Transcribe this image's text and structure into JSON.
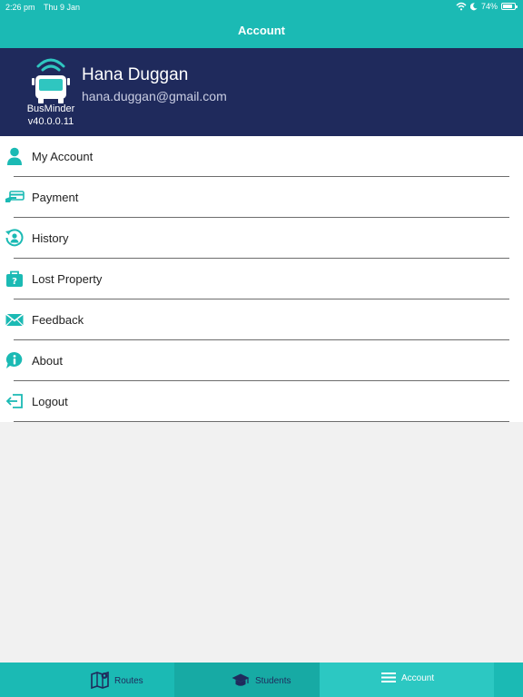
{
  "status_bar": {
    "time": "2:26 pm",
    "date": "Thu 9 Jan",
    "battery": "74%"
  },
  "header": {
    "title": "Account"
  },
  "profile": {
    "brand": "BusMinder",
    "version": "v40.0.0.11",
    "name": "Hana Duggan",
    "email": "hana.duggan@gmail.com"
  },
  "menu": {
    "items": [
      {
        "label": "My Account",
        "icon": "user-icon"
      },
      {
        "label": "Payment",
        "icon": "payment-icon"
      },
      {
        "label": "History",
        "icon": "history-icon"
      },
      {
        "label": "Lost Property",
        "icon": "lost-property-icon"
      },
      {
        "label": "Feedback",
        "icon": "envelope-icon"
      },
      {
        "label": "About",
        "icon": "info-icon"
      },
      {
        "label": "Logout",
        "icon": "logout-icon"
      }
    ]
  },
  "tabs": [
    {
      "label": "Routes",
      "icon": "map-icon"
    },
    {
      "label": "Students",
      "icon": "graduation-cap-icon"
    },
    {
      "label": "Account",
      "icon": "menu-icon",
      "active": true
    }
  ],
  "colors": {
    "teal": "#1bbab4",
    "navy": "#1f2a5c",
    "active_tab": "#2cc8c2"
  }
}
